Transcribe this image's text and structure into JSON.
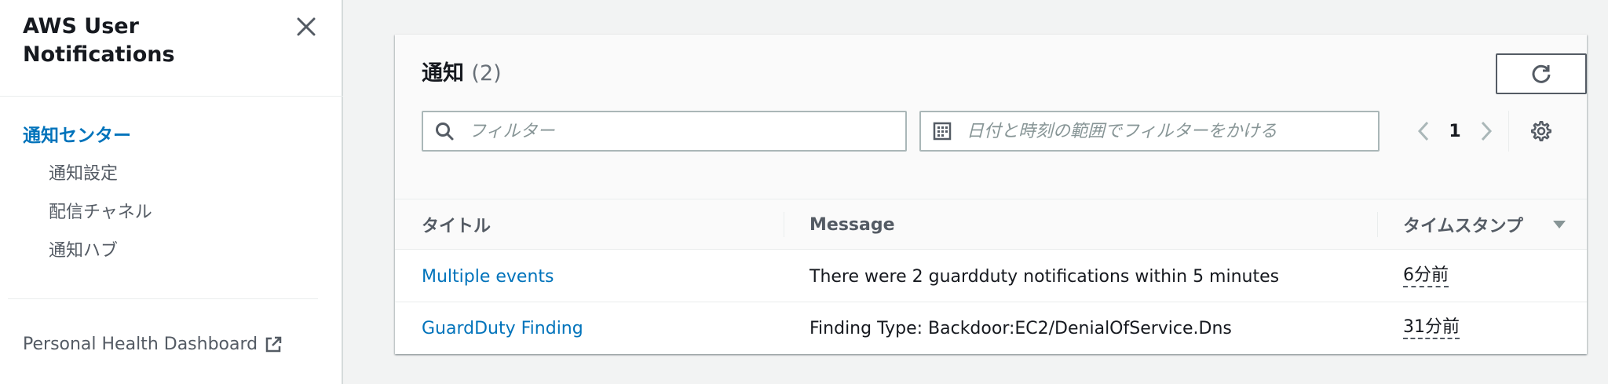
{
  "sidebar": {
    "title": "AWS User Notifications",
    "active_item": "通知センター",
    "items": [
      {
        "label": "通知設定"
      },
      {
        "label": "配信チャネル"
      },
      {
        "label": "通知ハブ"
      }
    ],
    "external_link": "Personal Health Dashboard"
  },
  "panel": {
    "title": "通知",
    "count": "(2)",
    "filter_placeholder": "フィルター",
    "date_filter_placeholder": "日付と時刻の範囲でフィルターをかける",
    "page": "1"
  },
  "table": {
    "headers": {
      "title": "タイトル",
      "message": "Message",
      "timestamp": "タイムスタンプ"
    },
    "rows": [
      {
        "title": "Multiple events",
        "message": "There were 2 guardduty notifications within 5 minutes",
        "timestamp": "6分前"
      },
      {
        "title": "GuardDuty Finding",
        "message": "Finding Type: Backdoor:EC2/DenialOfService.Dns",
        "timestamp": "31分前"
      }
    ]
  },
  "colors": {
    "accent": "#0073bb",
    "text": "#16191f",
    "muted": "#545b64",
    "placeholder": "#879596",
    "background": "#f2f3f3"
  },
  "icons": {
    "close": "close-icon",
    "external": "external-link-icon",
    "refresh": "refresh-icon",
    "search": "search-icon",
    "calendar": "calendar-icon",
    "prev": "chevron-left-icon",
    "next": "chevron-right-icon",
    "settings": "gear-icon",
    "sort": "sort-descending-icon"
  }
}
